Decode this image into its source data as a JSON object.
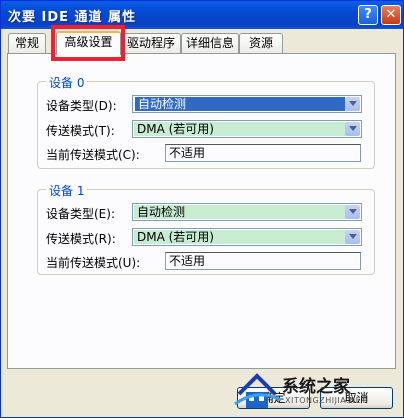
{
  "window": {
    "title": "次要 IDE 通道 属性",
    "help_glyph": "?",
    "close_glyph": "✕"
  },
  "tabs": [
    {
      "label": "常规",
      "active": false
    },
    {
      "label": "高级设置",
      "active": true
    },
    {
      "label": "驱动程序",
      "active": false
    },
    {
      "label": "详细信息",
      "active": false
    },
    {
      "label": "资源",
      "active": false
    }
  ],
  "device0": {
    "legend": "设备 0",
    "type_label": "设备类型(D):",
    "type_value": "自动检测",
    "transfer_label": "传送模式(T):",
    "transfer_value": "DMA (若可用)",
    "current_label": "当前传送模式(C):",
    "current_value": "不适用"
  },
  "device1": {
    "legend": "设备 1",
    "type_label": "设备类型(E):",
    "type_value": "自动检测",
    "transfer_label": "传送模式(R):",
    "transfer_value": "DMA (若可用)",
    "current_label": "当前传送模式(U):",
    "current_value": "不适用"
  },
  "buttons": {
    "ok": "确定",
    "cancel": "取消"
  },
  "watermark": {
    "text": "系统之家",
    "url": "XITONGZHIJIA.NET"
  },
  "colors": {
    "titlebar": "#0a4fd6",
    "highlight": "#f2202e",
    "legend": "#0046d5",
    "selection": "#316ac5",
    "combo_green": "#c8ecd2"
  },
  "icons": [
    "help-icon",
    "close-icon",
    "chevron-down-icon",
    "watermark-logo-icon"
  ]
}
